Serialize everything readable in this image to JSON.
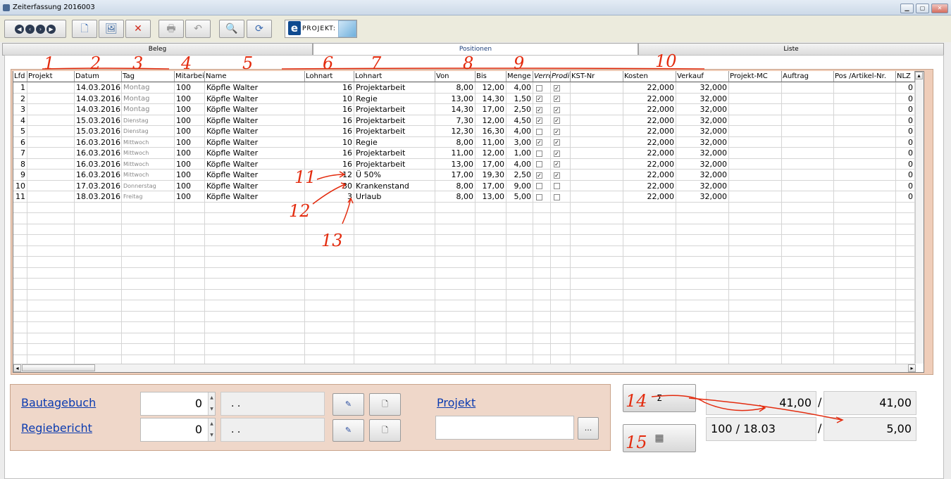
{
  "window": {
    "title": "Zeiterfassung 2016003",
    "minimize": "▁",
    "maximize": "▢",
    "close": "✕"
  },
  "toolbar": {
    "nav_first": "◀",
    "nav_prev": "‹",
    "nav_next": "›",
    "nav_last": "▶",
    "new": "🗋",
    "edit": "🖼",
    "delete": "✕",
    "print": "🖶",
    "undo": "↶",
    "search": "🔍",
    "refresh": "⟳",
    "eprojekt_e": "e",
    "eprojekt_label": "PROJEKT:"
  },
  "tabs": [
    {
      "label": "Beleg"
    },
    {
      "label": "Positionen"
    },
    {
      "label": "Liste"
    }
  ],
  "grid": {
    "columns": [
      "Lfd",
      "Projekt",
      "Datum",
      "Tag",
      "Mitarbei",
      "Name",
      "Lohnart",
      "Lohnart",
      "Von",
      "Bis",
      "Menge",
      "Verre",
      "Prodi",
      "KST-Nr",
      "Kosten",
      "Verkauf",
      "Projekt-MC",
      "Auftrag",
      "Pos /Artikel-Nr.",
      "NLZ"
    ],
    "rows": [
      {
        "lfd": "1",
        "projekt": "",
        "datum": "14.03.2016",
        "tag": "Montag",
        "mitarb": "100",
        "name": "Köpfle Walter",
        "lohnart_nr": "16",
        "lohnart": "Projektarbeit",
        "von": "8,00",
        "bis": "12,00",
        "menge": "4,00",
        "verre": "",
        "prod": "✓",
        "kst": "",
        "kosten": "22,000",
        "verkauf": "32,000",
        "pmc": "",
        "auftrag": "",
        "pos": "",
        "nlz": "0"
      },
      {
        "lfd": "2",
        "projekt": "",
        "datum": "14.03.2016",
        "tag": "Montag",
        "mitarb": "100",
        "name": "Köpfle Walter",
        "lohnart_nr": "10",
        "lohnart": "Regie",
        "von": "13,00",
        "bis": "14,30",
        "menge": "1,50",
        "verre": "✓",
        "prod": "✓",
        "kst": "",
        "kosten": "22,000",
        "verkauf": "32,000",
        "pmc": "",
        "auftrag": "",
        "pos": "",
        "nlz": "0"
      },
      {
        "lfd": "3",
        "projekt": "",
        "datum": "14.03.2016",
        "tag": "Montag",
        "mitarb": "100",
        "name": "Köpfle Walter",
        "lohnart_nr": "16",
        "lohnart": "Projektarbeit",
        "von": "14,30",
        "bis": "17,00",
        "menge": "2,50",
        "verre": "✓",
        "prod": "✓",
        "kst": "",
        "kosten": "22,000",
        "verkauf": "32,000",
        "pmc": "",
        "auftrag": "",
        "pos": "",
        "nlz": "0"
      },
      {
        "lfd": "4",
        "projekt": "",
        "datum": "15.03.2016",
        "tag": "Dienstag",
        "mitarb": "100",
        "name": "Köpfle Walter",
        "lohnart_nr": "16",
        "lohnart": "Projektarbeit",
        "von": "7,30",
        "bis": "12,00",
        "menge": "4,50",
        "verre": "✓",
        "prod": "✓",
        "kst": "",
        "kosten": "22,000",
        "verkauf": "32,000",
        "pmc": "",
        "auftrag": "",
        "pos": "",
        "nlz": "0"
      },
      {
        "lfd": "5",
        "projekt": "",
        "datum": "15.03.2016",
        "tag": "Dienstag",
        "mitarb": "100",
        "name": "Köpfle Walter",
        "lohnart_nr": "16",
        "lohnart": "Projektarbeit",
        "von": "12,30",
        "bis": "16,30",
        "menge": "4,00",
        "verre": "",
        "prod": "✓",
        "kst": "",
        "kosten": "22,000",
        "verkauf": "32,000",
        "pmc": "",
        "auftrag": "",
        "pos": "",
        "nlz": "0"
      },
      {
        "lfd": "6",
        "projekt": "",
        "datum": "16.03.2016",
        "tag": "Mittwoch",
        "mitarb": "100",
        "name": "Köpfle Walter",
        "lohnart_nr": "10",
        "lohnart": "Regie",
        "von": "8,00",
        "bis": "11,00",
        "menge": "3,00",
        "verre": "✓",
        "prod": "✓",
        "kst": "",
        "kosten": "22,000",
        "verkauf": "32,000",
        "pmc": "",
        "auftrag": "",
        "pos": "",
        "nlz": "0"
      },
      {
        "lfd": "7",
        "projekt": "",
        "datum": "16.03.2016",
        "tag": "Mittwoch",
        "mitarb": "100",
        "name": "Köpfle Walter",
        "lohnart_nr": "16",
        "lohnart": "Projektarbeit",
        "von": "11,00",
        "bis": "12,00",
        "menge": "1,00",
        "verre": "",
        "prod": "✓",
        "kst": "",
        "kosten": "22,000",
        "verkauf": "32,000",
        "pmc": "",
        "auftrag": "",
        "pos": "",
        "nlz": "0"
      },
      {
        "lfd": "8",
        "projekt": "",
        "datum": "16.03.2016",
        "tag": "Mittwoch",
        "mitarb": "100",
        "name": "Köpfle Walter",
        "lohnart_nr": "16",
        "lohnart": "Projektarbeit",
        "von": "13,00",
        "bis": "17,00",
        "menge": "4,00",
        "verre": "",
        "prod": "✓",
        "kst": "",
        "kosten": "22,000",
        "verkauf": "32,000",
        "pmc": "",
        "auftrag": "",
        "pos": "",
        "nlz": "0"
      },
      {
        "lfd": "9",
        "projekt": "",
        "datum": "16.03.2016",
        "tag": "Mittwoch",
        "mitarb": "100",
        "name": "Köpfle Walter",
        "lohnart_nr": "12",
        "lohnart": "Ü 50%",
        "von": "17,00",
        "bis": "19,30",
        "menge": "2,50",
        "verre": "✓",
        "prod": "✓",
        "kst": "",
        "kosten": "22,000",
        "verkauf": "32,000",
        "pmc": "",
        "auftrag": "",
        "pos": "",
        "nlz": "0"
      },
      {
        "lfd": "10",
        "projekt": "",
        "datum": "17.03.2016",
        "tag": "Donnerstag",
        "mitarb": "100",
        "name": "Köpfle Walter",
        "lohnart_nr": "30",
        "lohnart": "Krankenstand",
        "von": "8,00",
        "bis": "17,00",
        "menge": "9,00",
        "verre": "",
        "prod": "",
        "kst": "",
        "kosten": "22,000",
        "verkauf": "32,000",
        "pmc": "",
        "auftrag": "",
        "pos": "",
        "nlz": "0"
      },
      {
        "lfd": "11",
        "projekt": "",
        "datum": "18.03.2016",
        "tag": "Freitag",
        "mitarb": "100",
        "name": "Köpfle Walter",
        "lohnart_nr": "3",
        "lohnart": "Urlaub",
        "von": "8,00",
        "bis": "13,00",
        "menge": "5,00",
        "verre": "",
        "prod": "",
        "kst": "",
        "kosten": "22,000",
        "verkauf": "32,000",
        "pmc": "",
        "auftrag": "",
        "pos": "",
        "nlz": "0"
      }
    ]
  },
  "bottom": {
    "bautagebuch_label": "Bautagebuch",
    "bautagebuch_value": "0",
    "bautagebuch_date": ". .",
    "regiebericht_label": "Regiebericht",
    "regiebericht_value": "0",
    "regiebericht_date": ". .",
    "projekt_label": "Projekt",
    "projekt_value": "",
    "projekt_browse": "...",
    "spin_up": "▲",
    "spin_down": "▼",
    "btn_edit_icon": "✎",
    "btn_new_icon": "🗋"
  },
  "summary": {
    "sum_button": "Σ",
    "calc_button": "▦",
    "sum_left": "41,00",
    "sep1": "/",
    "sum_right": "41,00",
    "info_left": "100 / 18.03",
    "sep2": "/",
    "info_right": "5,00"
  },
  "annotations": [
    "1",
    "2",
    "3",
    "4",
    "5",
    "6",
    "7",
    "8",
    "9",
    "10",
    "11",
    "12",
    "13",
    "14",
    "15"
  ]
}
